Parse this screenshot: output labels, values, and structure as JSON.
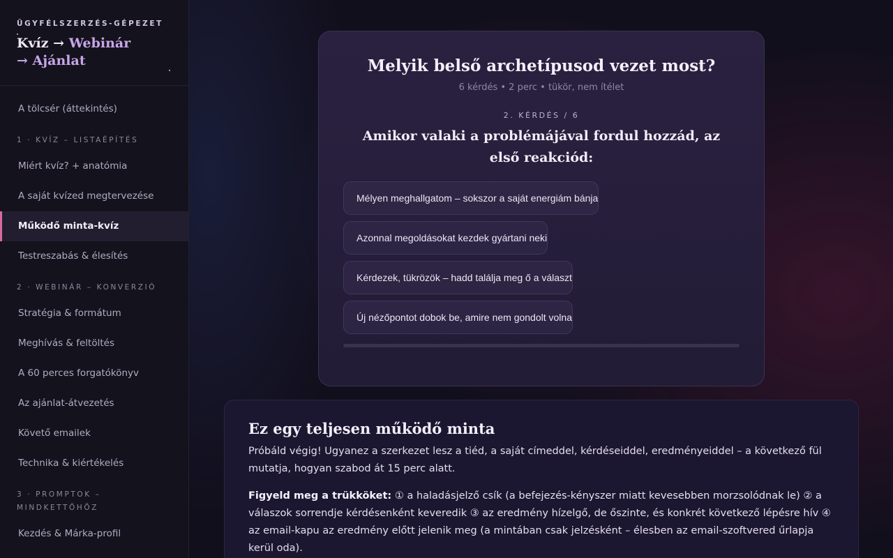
{
  "sidebar": {
    "kicker": "ÜGYFÉLSZERZÉS-GÉPEZET",
    "title_part1": "Kvíz",
    "title_arrow1": " → ",
    "title_part2": "Webinár",
    "title_arrow2": "→ ",
    "title_part3": "Ajánlat",
    "overview": "A tölcsér (áttekintés)",
    "section1": "1 · KVÍZ – LISTAÉPÍTÉS",
    "section1_items": [
      "Miért kvíz? + anatómia",
      "A saját kvízed megtervezése",
      "Működő minta-kvíz",
      "Testreszabás & élesítés"
    ],
    "section2": "2 · WEBINÁR – KONVERZIÓ",
    "section2_items": [
      "Stratégia & formátum",
      "Meghívás & feltöltés",
      "A 60 perces forgatókönyv",
      "Az ajánlat-átvezetés",
      "Követő emailek",
      "Technika & kiértékelés"
    ],
    "section3": "3 · PROMPTOK – MINDKETTŐHÖZ",
    "section3_items": [
      "Kezdés & Márka-profil"
    ],
    "active_item": "Működő minta-kvíz"
  },
  "quiz": {
    "title": "Melyik belső archetípusod vezet most?",
    "meta": "6 kérdés • 2 perc • tükör, nem ítélet",
    "counter": "2. KÉRDÉS / 6",
    "question": "Amikor valaki a problémájával fordul hozzád, az első reakciód:",
    "answers": [
      "Mélyen meghallgatom – sokszor a saját energiám bánja",
      "Azonnal megoldásokat kezdek gyártani neki",
      "Kérdezek, tükrözök – hadd találja meg ő a választ",
      "Új nézőpontot dobok be, amire nem gondolt volna"
    ],
    "progress": 0.0,
    "accent_color": "#cc6fa8"
  },
  "info": {
    "title": "Ez egy teljesen működő minta",
    "paragraph1": "Próbáld végig! Ugyanez a szerkezet lesz a tiéd, a saját címeddel, kérdéseiddel, eredményeiddel – a következő fül mutatja, hogyan szabod át 15 perc alatt.",
    "paragraph2_bold": "Figyeld meg a trükköket:",
    "paragraph2_text": " ① a haladásjelző csík (a befejezés-kényszer miatt kevesebben morzsolódnak le) ② a válaszok sorrendje kérdésenként keveredik ③ az eredmény hízelgő, de őszinte, és konkrét következő lépésre hív ④ az email-kapu az eredmény előtt jelenik meg (a mintában csak jelzésként – élesben az email-szoftvered űrlapja kerül oda)."
  }
}
